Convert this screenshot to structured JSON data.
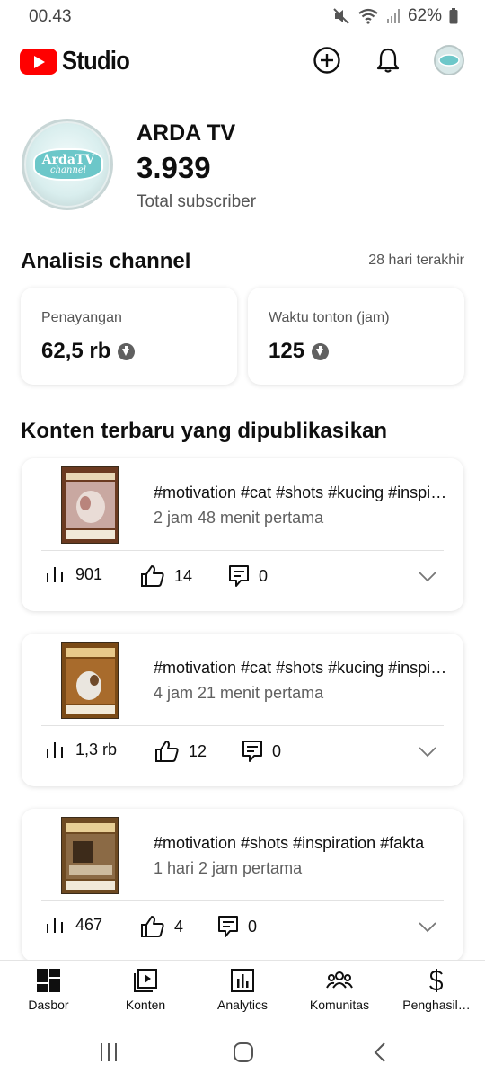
{
  "status": {
    "time": "00.43",
    "battery": "62%"
  },
  "app": {
    "title": "Studio"
  },
  "channel": {
    "name": "ARDA TV",
    "avatar_text": "ArdaTV",
    "avatar_subtext": "channel",
    "subscribers": "3.939",
    "subscribers_label": "Total subscriber"
  },
  "analytics": {
    "title": "Analisis channel",
    "period": "28 hari terakhir",
    "views": {
      "label": "Penayangan",
      "value": "62,5 rb"
    },
    "watch_time": {
      "label": "Waktu tonton (jam)",
      "value": "125"
    }
  },
  "recent": {
    "title": "Konten terbaru yang dipublikasikan",
    "items": [
      {
        "title": "#motivation #cat #shots #kucing #inspiration",
        "time": "2 jam 48 menit pertama",
        "views": "901",
        "likes": "14",
        "comments": "0"
      },
      {
        "title": "#motivation #cat #shots #kucing #inspiration",
        "time": "4 jam 21 menit pertama",
        "views": "1,3 rb",
        "likes": "12",
        "comments": "0"
      },
      {
        "title": "#motivation #shots #inspiration #fakta",
        "time": "1 hari 2 jam pertama",
        "views": "467",
        "likes": "4",
        "comments": "0"
      }
    ]
  },
  "nav": {
    "items": [
      {
        "label": "Dasbor",
        "icon": "dashboard-icon"
      },
      {
        "label": "Konten",
        "icon": "content-icon"
      },
      {
        "label": "Analytics",
        "icon": "analytics-icon"
      },
      {
        "label": "Komunitas",
        "icon": "community-icon"
      },
      {
        "label": "Penghasil…",
        "icon": "earn-icon"
      }
    ]
  },
  "colors": {
    "brand": "#ff0000",
    "text": "#0f0f0f",
    "secondary": "#606060"
  }
}
